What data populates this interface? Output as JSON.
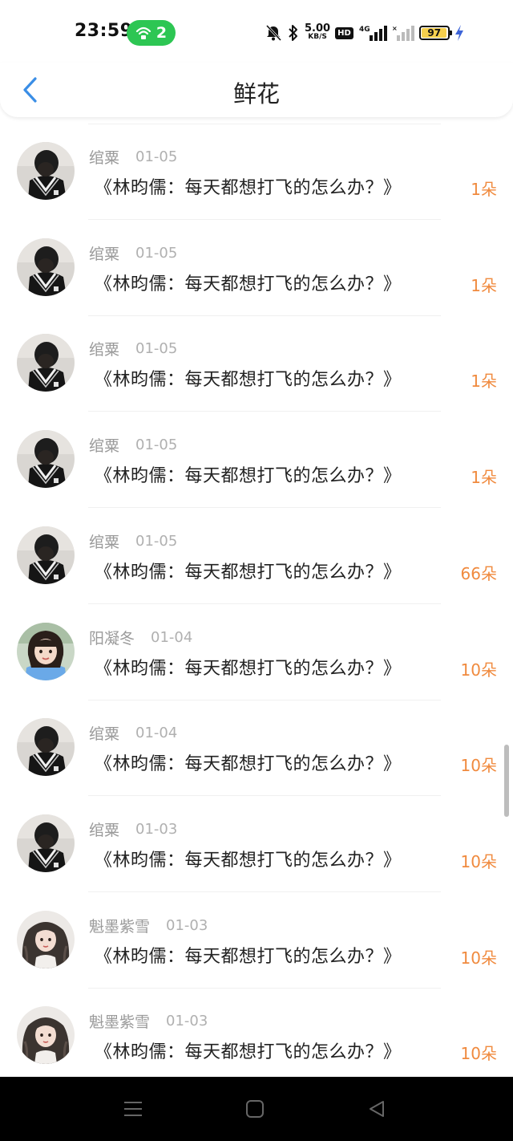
{
  "status_bar": {
    "time": "23:59",
    "hotspot_count": "2",
    "net_speed_value": "5.00",
    "net_speed_unit": "KB/S",
    "hd_label": "HD",
    "network_label": "4G",
    "battery_level": "97",
    "battery_fraction": 0.97,
    "colors": {
      "hotspot": "#2dc653",
      "battery_fill": "#f6d04d",
      "charging": "#3d64d8"
    },
    "icons": [
      "hotspot-icon",
      "mute-bell-icon",
      "bluetooth-icon",
      "hd-icon",
      "signal-4g-icon",
      "signal-2-icon",
      "battery-icon",
      "charging-icon"
    ]
  },
  "header": {
    "title": "鲜花",
    "back_icon": "chevron-left-icon",
    "accent_color": "#3a8ee6"
  },
  "accent": {
    "flower_count_color": "#f08a3e"
  },
  "list": [
    {
      "user": "绾粟",
      "date": "01-05",
      "title": "《林昀儒：每天都想打飞的怎么办？》",
      "count": "1朵",
      "avatar": "boy"
    },
    {
      "user": "绾粟",
      "date": "01-05",
      "title": "《林昀儒：每天都想打飞的怎么办？》",
      "count": "1朵",
      "avatar": "boy"
    },
    {
      "user": "绾粟",
      "date": "01-05",
      "title": "《林昀儒：每天都想打飞的怎么办？》",
      "count": "1朵",
      "avatar": "boy"
    },
    {
      "user": "绾粟",
      "date": "01-05",
      "title": "《林昀儒：每天都想打飞的怎么办？》",
      "count": "1朵",
      "avatar": "boy"
    },
    {
      "user": "绾粟",
      "date": "01-05",
      "title": "《林昀儒：每天都想打飞的怎么办？》",
      "count": "66朵",
      "avatar": "boy"
    },
    {
      "user": "阳凝冬",
      "date": "01-04",
      "title": "《林昀儒：每天都想打飞的怎么办？》",
      "count": "10朵",
      "avatar": "girl-blue"
    },
    {
      "user": "绾粟",
      "date": "01-04",
      "title": "《林昀儒：每天都想打飞的怎么办？》",
      "count": "10朵",
      "avatar": "boy"
    },
    {
      "user": "绾粟",
      "date": "01-03",
      "title": "《林昀儒：每天都想打飞的怎么办？》",
      "count": "10朵",
      "avatar": "boy"
    },
    {
      "user": "魁墨紫雪",
      "date": "01-03",
      "title": "《林昀儒：每天都想打飞的怎么办？》",
      "count": "10朵",
      "avatar": "girl-curly"
    },
    {
      "user": "魁墨紫雪",
      "date": "01-03",
      "title": "《林昀儒：每天都想打飞的怎么办？》",
      "count": "10朵",
      "avatar": "girl-curly"
    }
  ],
  "nav_bar": {
    "icons": [
      "menu-icon",
      "home-square-icon",
      "back-triangle-icon"
    ]
  }
}
